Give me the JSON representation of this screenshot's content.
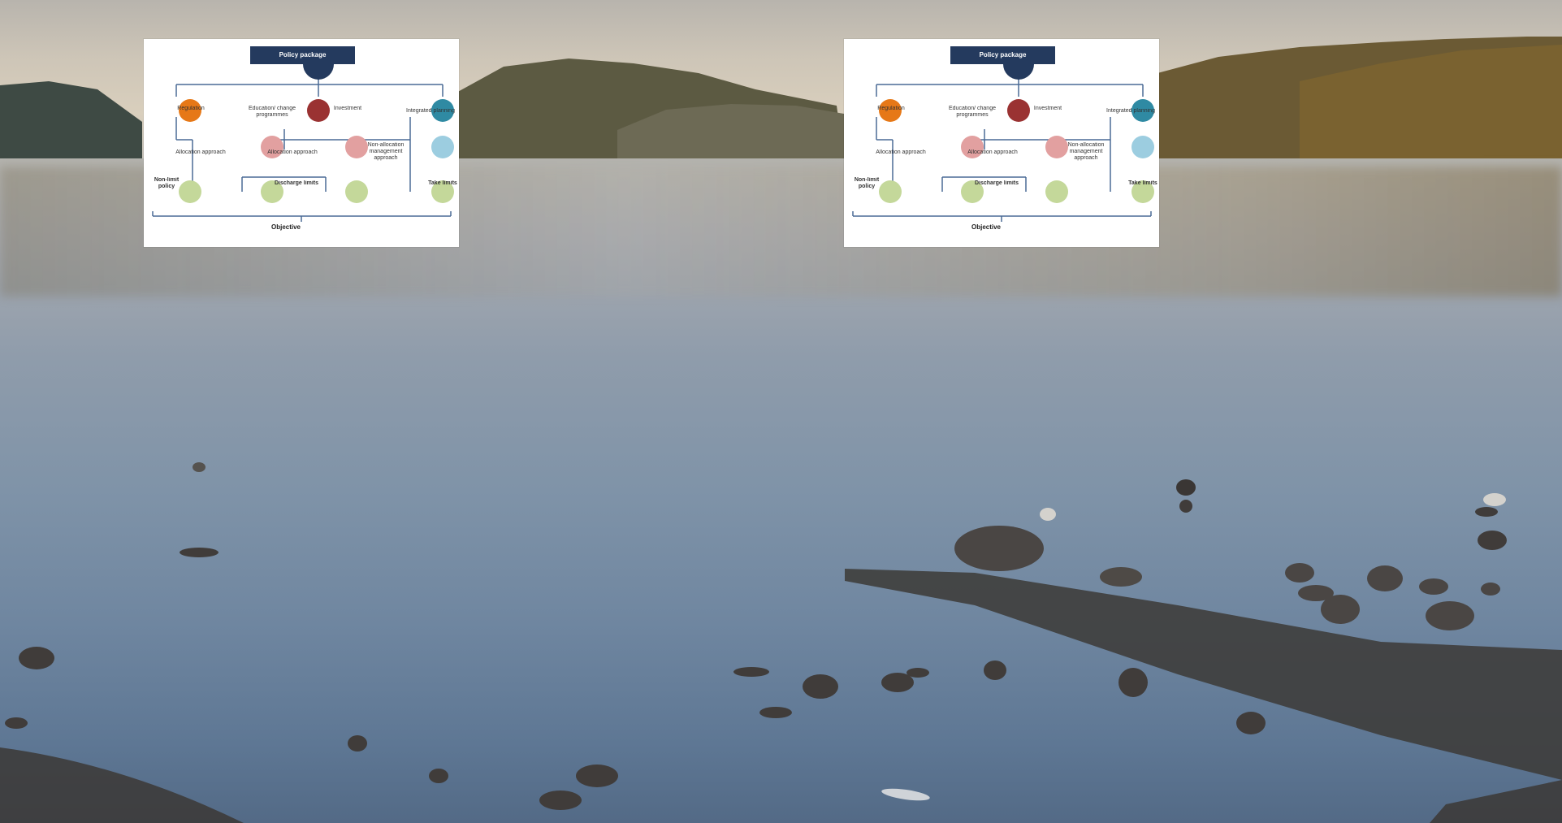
{
  "diagrams": [
    {
      "title": "Policy package",
      "top_row": [
        "Integrated planning",
        "Investment",
        "Education/ change programmes",
        "Regulation"
      ],
      "middle_row": [
        "Non-allocation management approach",
        "Allocation approach",
        "Allocation approach"
      ],
      "lower_row": [
        "Non-limit policy",
        "Discharge limits",
        "Take limits"
      ],
      "objective": "Objective"
    },
    {
      "title": "Policy package",
      "top_row": [
        "Integrated planning",
        "Investment",
        "Education/ change programmes",
        "Regulation"
      ],
      "middle_row": [
        "Non-allocation management approach",
        "Allocation approach",
        "Allocation approach"
      ],
      "lower_row": [
        "Non-limit policy",
        "Discharge limits",
        "Take limits"
      ],
      "objective": "Objective"
    }
  ],
  "colors": {
    "green": "#c4d89a",
    "pink": "#e2a0a0",
    "light_blue": "#9ccde0",
    "teal": "#2f8aa3",
    "orange": "#e67817",
    "dark_red": "#9a3232",
    "navy": "#243a5e"
  }
}
